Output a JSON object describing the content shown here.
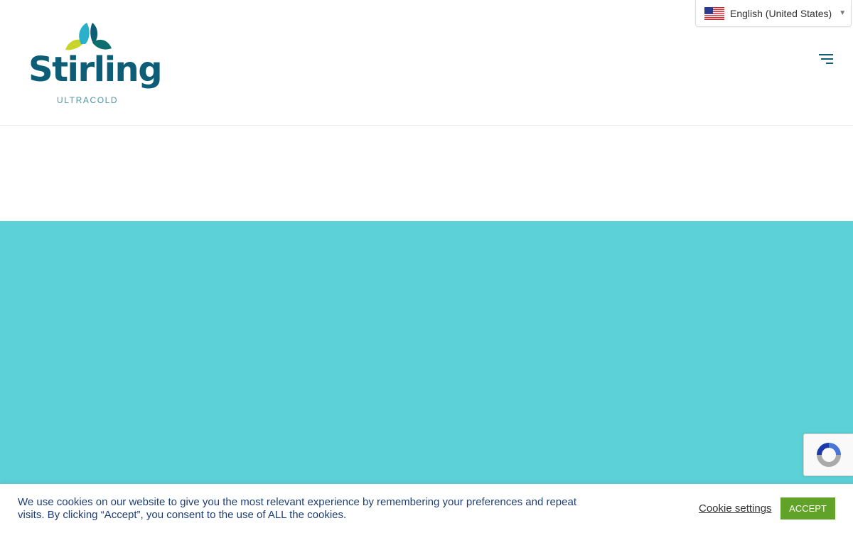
{
  "header": {
    "logo": {
      "name": "Stirling",
      "subtitle": "ULTRACOLD"
    },
    "language": {
      "selected": "English (United States)",
      "flag_icon": "us-flag-icon"
    },
    "menu_icon": "hamburger-menu-icon"
  },
  "hero": {
    "background": "#5dd1d8"
  },
  "recaptcha": {
    "icon": "recaptcha-icon"
  },
  "cookie_banner": {
    "message": "We use cookies on our website to give you the most relevant experience by remembering your preferences and repeat visits. By clicking “Accept”, you consent to the use of ALL the cookies.",
    "settings_label": "Cookie settings",
    "accept_label": "ACCEPT"
  },
  "colors": {
    "brand_teal": "#0c5d75",
    "hero": "#5dd1d8",
    "accept_green": "#61a229",
    "cookie_text": "#1d3e75"
  }
}
